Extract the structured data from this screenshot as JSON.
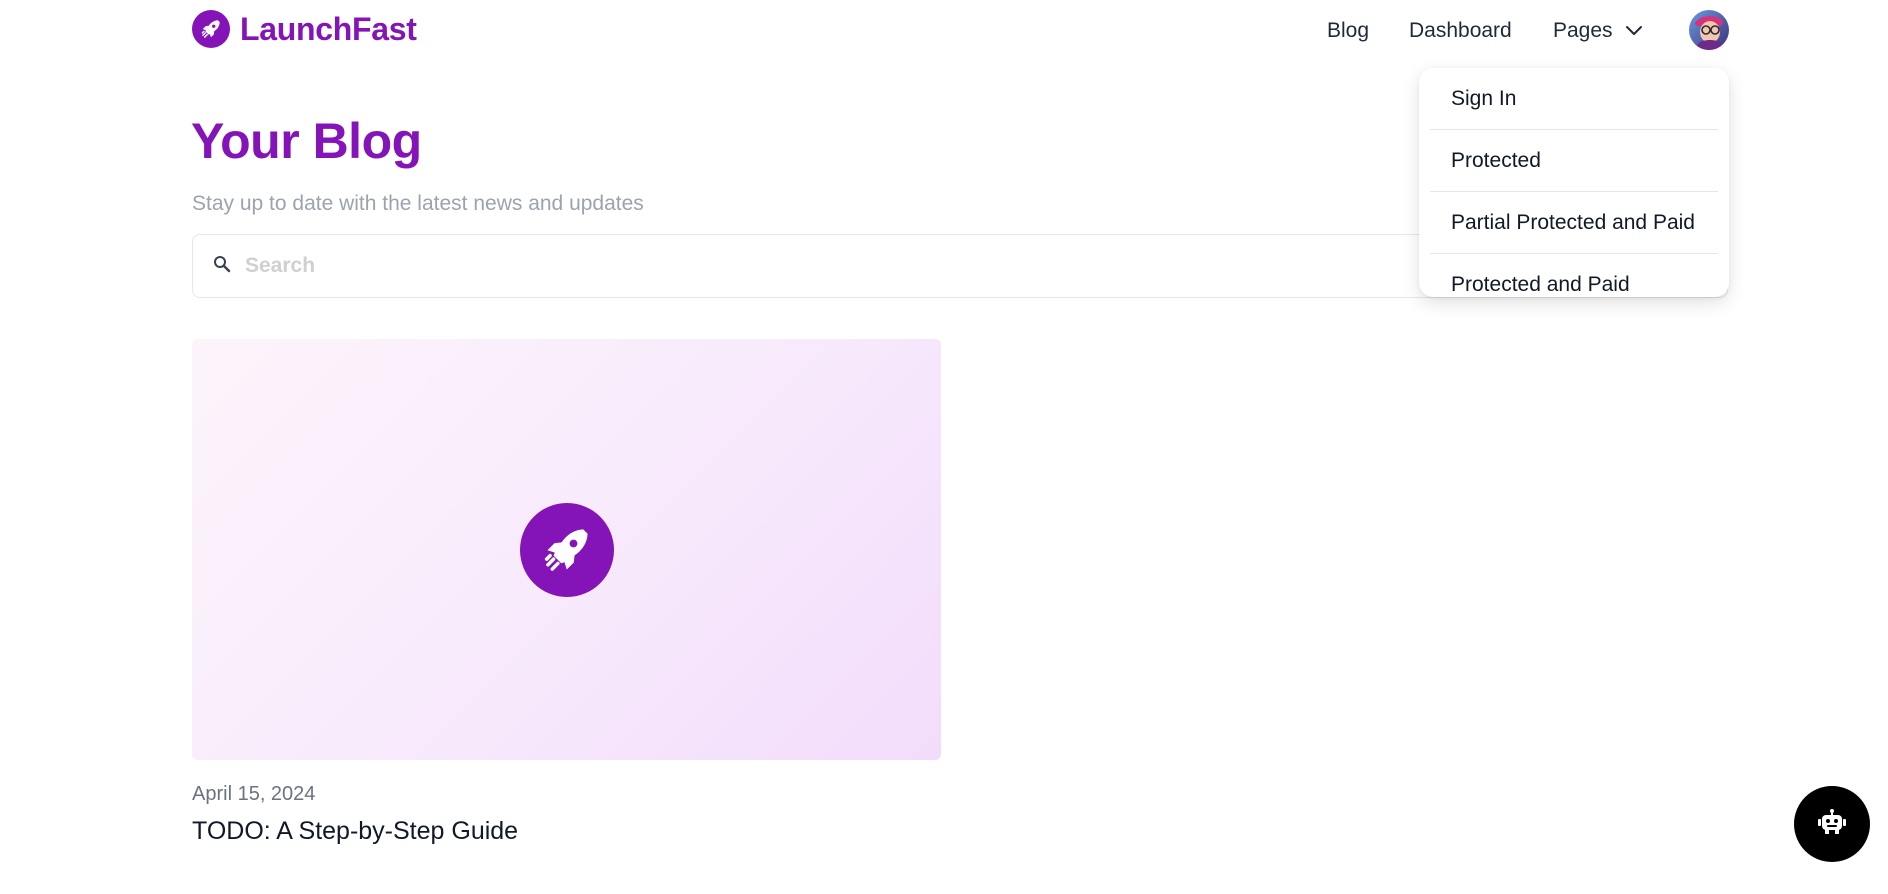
{
  "header": {
    "brand_name": "LaunchFast",
    "nav": {
      "blog": "Blog",
      "dashboard": "Dashboard",
      "pages": "Pages"
    }
  },
  "pages_menu": {
    "items": [
      {
        "label": "Sign In"
      },
      {
        "label": "Protected"
      },
      {
        "label": "Partial Protected and Paid"
      },
      {
        "label": "Protected and Paid"
      }
    ]
  },
  "main": {
    "title": "Your Blog",
    "subtitle": "Stay up to date with the latest news and updates",
    "search": {
      "placeholder": "Search",
      "value": ""
    },
    "posts": [
      {
        "date": "April 15, 2024",
        "title": "TODO: A Step-by-Step Guide"
      }
    ]
  },
  "icons": {
    "brand": "rocket-icon",
    "search": "search-icon",
    "pages_toggle": "chevron-down-icon",
    "post_image": "rocket-icon",
    "chat": "robot-icon"
  },
  "colors": {
    "brand": "#8414b8",
    "text": "#111827",
    "muted": "#9ca3af",
    "fab": "#000000"
  }
}
